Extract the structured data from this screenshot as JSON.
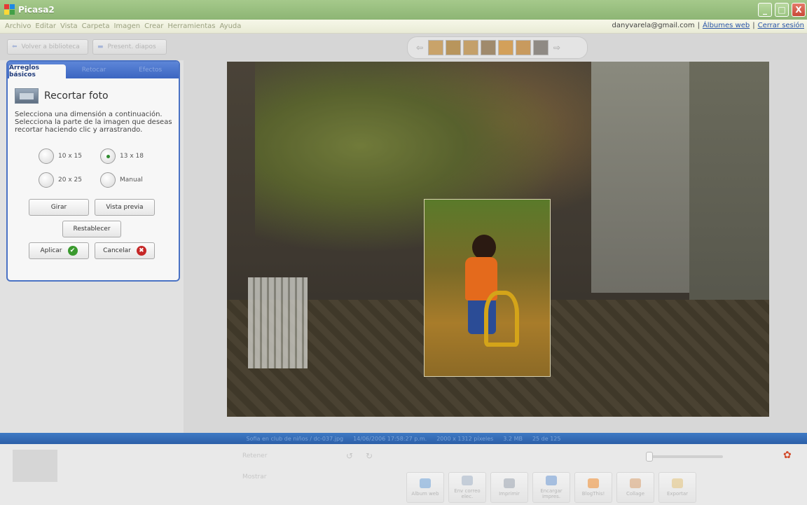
{
  "window": {
    "title": "Picasa2",
    "minimize": "_",
    "maximize": "□",
    "close": "X"
  },
  "menu": {
    "items": [
      "Archivo",
      "Editar",
      "Vista",
      "Carpeta",
      "Imagen",
      "Crear",
      "Herramientas",
      "Ayuda"
    ]
  },
  "account": {
    "email": "danyvarela@gmail.com",
    "separator": "|",
    "albums_link": "Álbumes web",
    "logout_link": "Cerrar sesión"
  },
  "toolbar": {
    "back_label": "Volver a biblioteca",
    "slideshow_label": "Present. diapos"
  },
  "filmstrip": {
    "prev": "⇦",
    "next": "⇨",
    "thumb_colors": [
      "#c9a36a",
      "#b8955c",
      "#c4a06a",
      "#a08a6c",
      "#d3a05a",
      "#c89a5e",
      "#8f8a84"
    ]
  },
  "editor": {
    "tabs": [
      "Arreglos básicos",
      "Retocar",
      "Efectos"
    ],
    "title": "Recortar foto",
    "instructions": "Selecciona una dimensión a continuación. Selecciona la parte de la imagen que deseas recortar haciendo clic y arrastrando.",
    "options": [
      {
        "label": "10 x 15",
        "selected": false
      },
      {
        "label": "13 x 18",
        "selected": true
      },
      {
        "label": "20 x 25",
        "selected": false
      },
      {
        "label": "Manual",
        "selected": false
      }
    ],
    "buttons": {
      "rotate": "Girar",
      "preview": "Vista previa",
      "reset": "Restablecer",
      "apply": "Aplicar",
      "cancel": "Cancelar"
    },
    "accent_color": "#4a72c4"
  },
  "status": {
    "path": "Sofia en club de niños / dc-037.jpg",
    "date": "14/06/2006 17:58:27 p.m.",
    "dimensions": "2000 x 1312 píxeles",
    "size": "3.2 MB",
    "position": "25 de 125"
  },
  "bottom": {
    "shortcuts": [
      "Album web",
      "Env correo elec.",
      "Imprimir",
      "Encargar impres.",
      "BlogThis!",
      "Collage",
      "Exportar"
    ],
    "hold_label": "Retener",
    "show_label": "Mostrar"
  }
}
